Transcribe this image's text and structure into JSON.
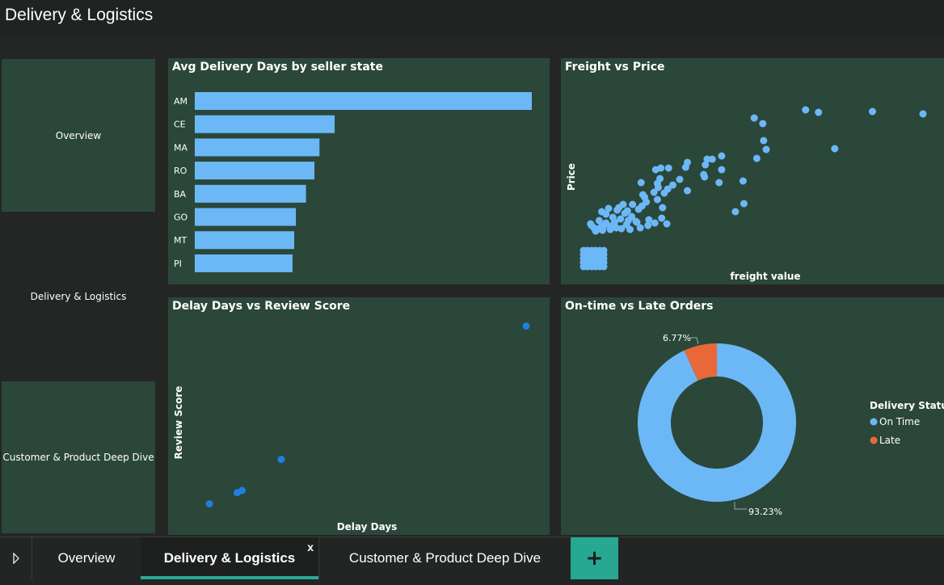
{
  "header": {
    "title": "Delivery & Logistics"
  },
  "nav": {
    "overview": "Overview",
    "delivery": "Delivery & Logistics",
    "customer": "Customer & Product Deep Dive"
  },
  "colors": {
    "panel": "#2b473a",
    "bar": "#6cb8f6",
    "late": "#e8683a",
    "point_dark": "#1f7fe0",
    "accent": "#2aa895"
  },
  "charts": {
    "bar": {
      "title": "Avg Delivery Days by seller state"
    },
    "freight": {
      "title": "Freight vs Price",
      "xlabel": "freight value",
      "ylabel": "Price"
    },
    "delay": {
      "title": "Delay Days vs Review Score",
      "xlabel": "Delay Days",
      "ylabel": "Review Score"
    },
    "donut": {
      "title": "On-time vs Late Orders",
      "legend_title": "Delivery Status"
    }
  },
  "chart_data": [
    {
      "type": "bar",
      "orientation": "horizontal",
      "title": "Avg Delivery Days by seller state",
      "categories": [
        "AM",
        "CE",
        "MA",
        "RO",
        "BA",
        "GO",
        "MT",
        "PI"
      ],
      "values": [
        100,
        41.5,
        37,
        35.5,
        33,
        30,
        29.5,
        29
      ],
      "grid": false
    },
    {
      "type": "scatter",
      "title": "Freight vs Price",
      "xlabel": "freight value",
      "ylabel": "Price",
      "x": [
        203,
        263,
        278,
        341,
        400,
        213,
        214,
        297,
        217,
        165,
        154,
        148,
        125,
        206,
        190,
        146,
        123,
        165,
        144,
        162,
        191,
        181,
        94,
        103,
        88,
        145,
        116,
        125,
        93,
        90,
        108,
        102,
        91,
        98,
        71,
        73,
        86,
        75,
        90,
        96,
        77,
        72,
        61,
        68,
        50,
        55,
        45,
        43,
        52,
        60,
        33,
        25,
        30,
        38,
        47,
        56,
        65,
        80,
        87,
        95,
        101,
        79,
        66,
        54,
        40,
        30,
        22,
        28,
        24,
        36,
        42,
        48,
        58,
        70,
        13,
        16,
        20,
        12,
        18,
        26,
        35
      ],
      "y": [
        188,
        198,
        195,
        196,
        193,
        181,
        160,
        150,
        149,
        141,
        137,
        137,
        133,
        138,
        110,
        130,
        127,
        124,
        118,
        108,
        82,
        72,
        126,
        126,
        124,
        115,
        112,
        98,
        113,
        107,
        105,
        100,
        102,
        95,
        108,
        93,
        96,
        90,
        87,
        77,
        84,
        79,
        81,
        75,
        81,
        73,
        77,
        74,
        70,
        66,
        76,
        72,
        69,
        65,
        63,
        61,
        60,
        62,
        58,
        64,
        57,
        55,
        59,
        56,
        59,
        58,
        61,
        55,
        53,
        54,
        52,
        51,
        50,
        52,
        55,
        52,
        50,
        57,
        48,
        49,
        50
      ],
      "grid": false
    },
    {
      "type": "scatter",
      "title": "Delay Days vs Review Score",
      "xlabel": "Delay Days",
      "ylabel": "Review Score",
      "x": [
        6,
        23,
        26,
        50,
        200
      ],
      "y": [
        1,
        1.5,
        1.6,
        3,
        9
      ],
      "grid": false
    },
    {
      "type": "pie",
      "donut": true,
      "title": "On-time vs Late Orders",
      "legend_title": "Delivery Status",
      "legend_position": "right",
      "categories": [
        "On Time",
        "Late"
      ],
      "values": [
        93.23,
        6.77
      ],
      "labels": [
        "93.23%",
        "6.77%"
      ]
    }
  ],
  "tabs": [
    {
      "label": "Overview"
    },
    {
      "label": "Delivery & Logistics",
      "close": "x"
    },
    {
      "label": "Customer & Product Deep Dive"
    }
  ],
  "add_tab": "+"
}
